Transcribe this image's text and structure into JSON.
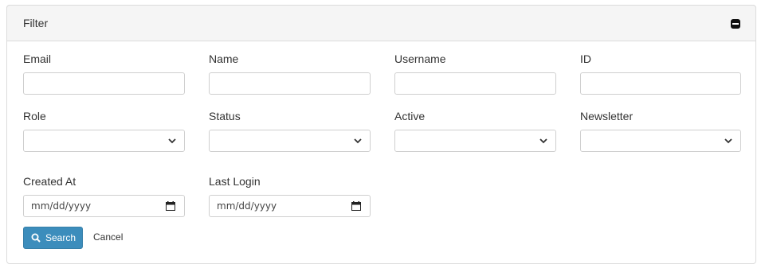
{
  "panel": {
    "title": "Filter"
  },
  "fields": {
    "email": {
      "label": "Email",
      "value": ""
    },
    "name": {
      "label": "Name",
      "value": ""
    },
    "username": {
      "label": "Username",
      "value": ""
    },
    "id": {
      "label": "ID",
      "value": ""
    },
    "role": {
      "label": "Role",
      "selected": ""
    },
    "status": {
      "label": "Status",
      "selected": ""
    },
    "active": {
      "label": "Active",
      "selected": ""
    },
    "newsletter": {
      "label": "Newsletter",
      "selected": ""
    },
    "created_at": {
      "label": "Created At",
      "placeholder": "mm/dd/yyyy"
    },
    "last_login": {
      "label": "Last Login",
      "placeholder": "mm/dd/yyyy"
    }
  },
  "actions": {
    "search_label": "Search",
    "cancel_label": "Cancel"
  },
  "colors": {
    "primary_button": "#3c8dbc",
    "header_background": "#f5f5f5"
  }
}
